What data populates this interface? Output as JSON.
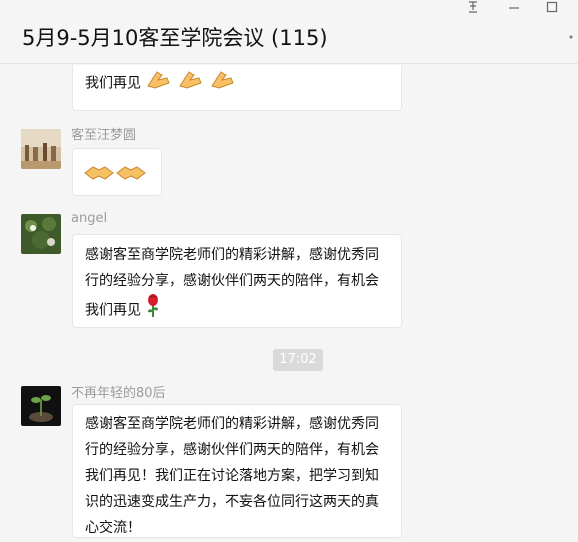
{
  "window": {
    "title": "5月9-5月10客至学院会议 (115)",
    "pin_icon": "pin-icon",
    "min_icon": "minimize-icon",
    "max_icon": "maximize-icon",
    "more_icon": "more-icon"
  },
  "messages": [
    {
      "text": "我们再见"
    },
    {
      "sender": "客至汪梦圆"
    },
    {
      "sender": "angel",
      "text": "感谢客至商学院老师们的精彩讲解，感谢优秀同行的经验分享，感谢伙伴们两天的陪伴，有机会我们再见"
    },
    {
      "time": "17:02"
    },
    {
      "sender": "不再年轻的80后",
      "text": "感谢客至商学院老师们的精彩讲解，感谢优秀同行的经验分享，感谢伙伴们两天的陪伴，有机会我们再见！我们正在讨论落地方案，把学习到知识的迅速变成生产力，不妄各位同行这两天的真心交流！"
    }
  ],
  "colors": {
    "background": "#f5f5f5",
    "bubble": "#ffffff",
    "sender": "#9b9b9b",
    "time_pill": "#dadada"
  }
}
